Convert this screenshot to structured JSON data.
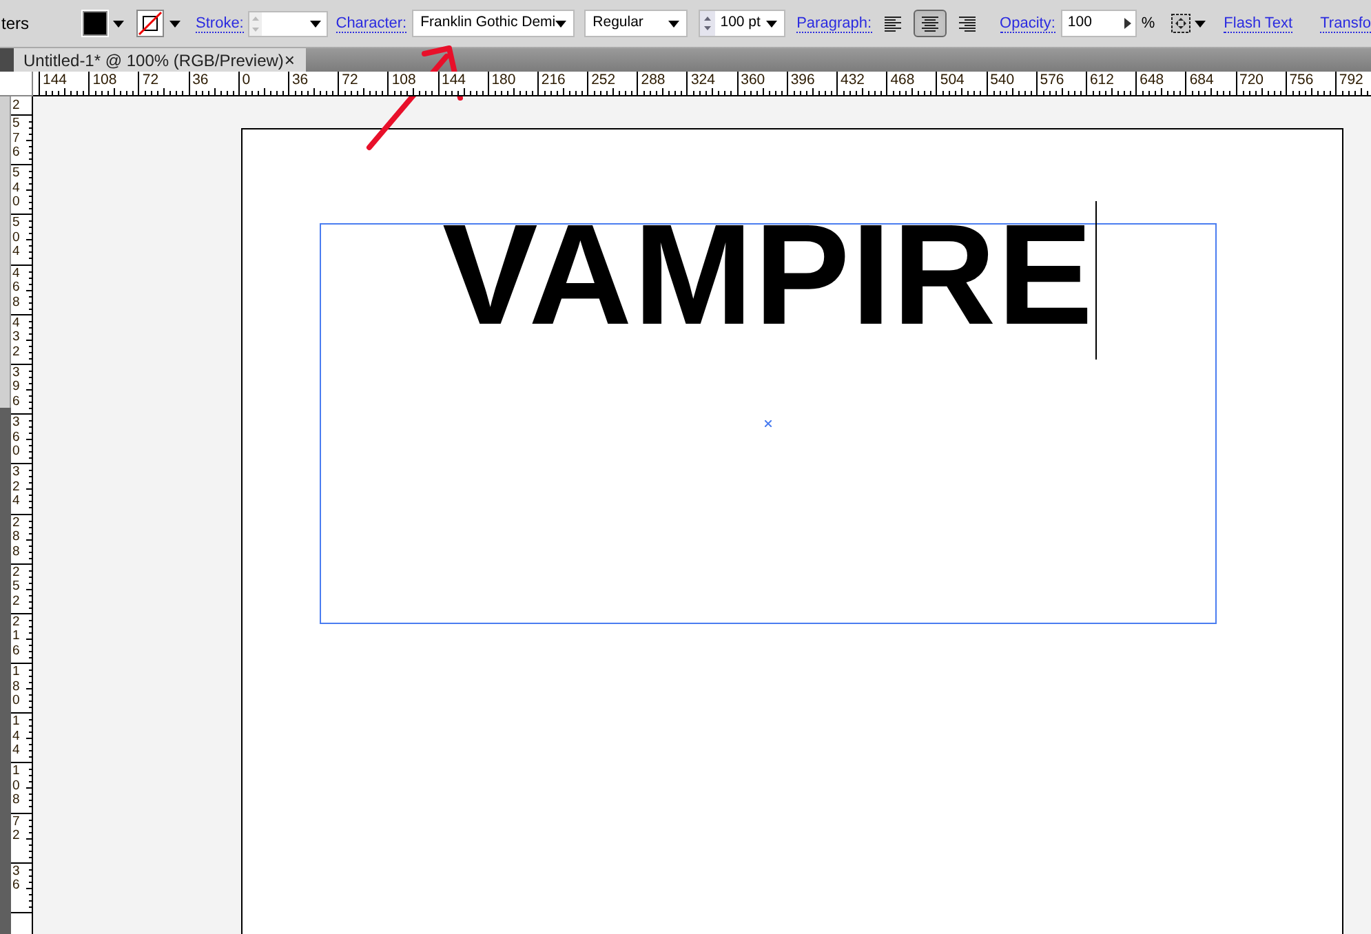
{
  "control_bar": {
    "cut_label": "ters",
    "fill": {
      "color": "#000000"
    },
    "stroke_swatch": {
      "none": true
    },
    "stroke_link": "Stroke:",
    "character_link": "Character:",
    "font_family": "Franklin Gothic Demi",
    "font_style": "Regular",
    "font_size": "100 pt",
    "paragraph_link": "Paragraph:",
    "align": [
      {
        "kind": "left",
        "selected": false
      },
      {
        "kind": "center",
        "selected": true
      },
      {
        "kind": "right",
        "selected": false
      }
    ],
    "opacity_link": "Opacity:",
    "opacity_value": "100",
    "percent": "%",
    "flash_text_link": "Flash Text",
    "transform_link": "Transfo"
  },
  "document_tab": {
    "title": "Untitled-1* @ 100% (RGB/Preview)",
    "close": "×"
  },
  "horizontal_ruler": [
    "144",
    "108",
    "72",
    "36",
    "0",
    "36",
    "72",
    "108",
    "144",
    "180",
    "216",
    "252",
    "288",
    "324",
    "360",
    "396",
    "432",
    "468",
    "504",
    "540",
    "576",
    "612",
    "648",
    "684",
    "720",
    "756",
    "792"
  ],
  "vertical_ruler": [
    "2",
    "576",
    "540",
    "504",
    "468",
    "432",
    "396",
    "360",
    "324",
    "288",
    "252",
    "216",
    "180",
    "144",
    "108",
    "72",
    "36"
  ],
  "artboard": {
    "text": "VAMPIRE"
  }
}
